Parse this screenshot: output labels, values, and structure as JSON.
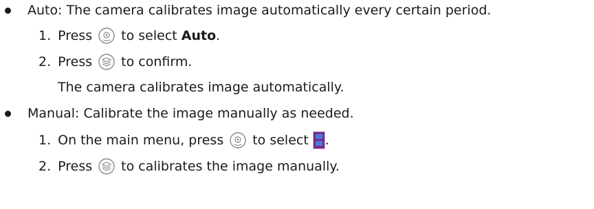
{
  "bullets": [
    {
      "label": "Auto",
      "text": ": The camera calibrates image automatically every certain period.",
      "steps": [
        {
          "num": "1.",
          "before": "Press",
          "icon": "scroll-wheel-icon",
          "after_pre": "to select ",
          "after_bold": "Auto",
          "after_post": "."
        },
        {
          "num": "2.",
          "before": "Press",
          "icon": "confirm-button-icon",
          "after": "to confirm."
        }
      ],
      "result": "The camera calibrates image automatically."
    },
    {
      "label": "Manual",
      "text": ": Calibrate the image manually as needed.",
      "steps": [
        {
          "num": "1.",
          "before": "On the main menu, press",
          "icon": "scroll-wheel-icon",
          "after": "to select",
          "menu_icon": "calibration-menu-icon",
          "after_post": "."
        },
        {
          "num": "2.",
          "before": "Press",
          "icon": "confirm-button-icon",
          "after": "to calibrates the image manually."
        }
      ]
    }
  ],
  "colors": {
    "text": "#1a1a1a",
    "icon_stroke": "#8a8a8a",
    "menu_icon_bg": "#7a2a8a",
    "menu_icon_fill": "#4a7ad8"
  }
}
